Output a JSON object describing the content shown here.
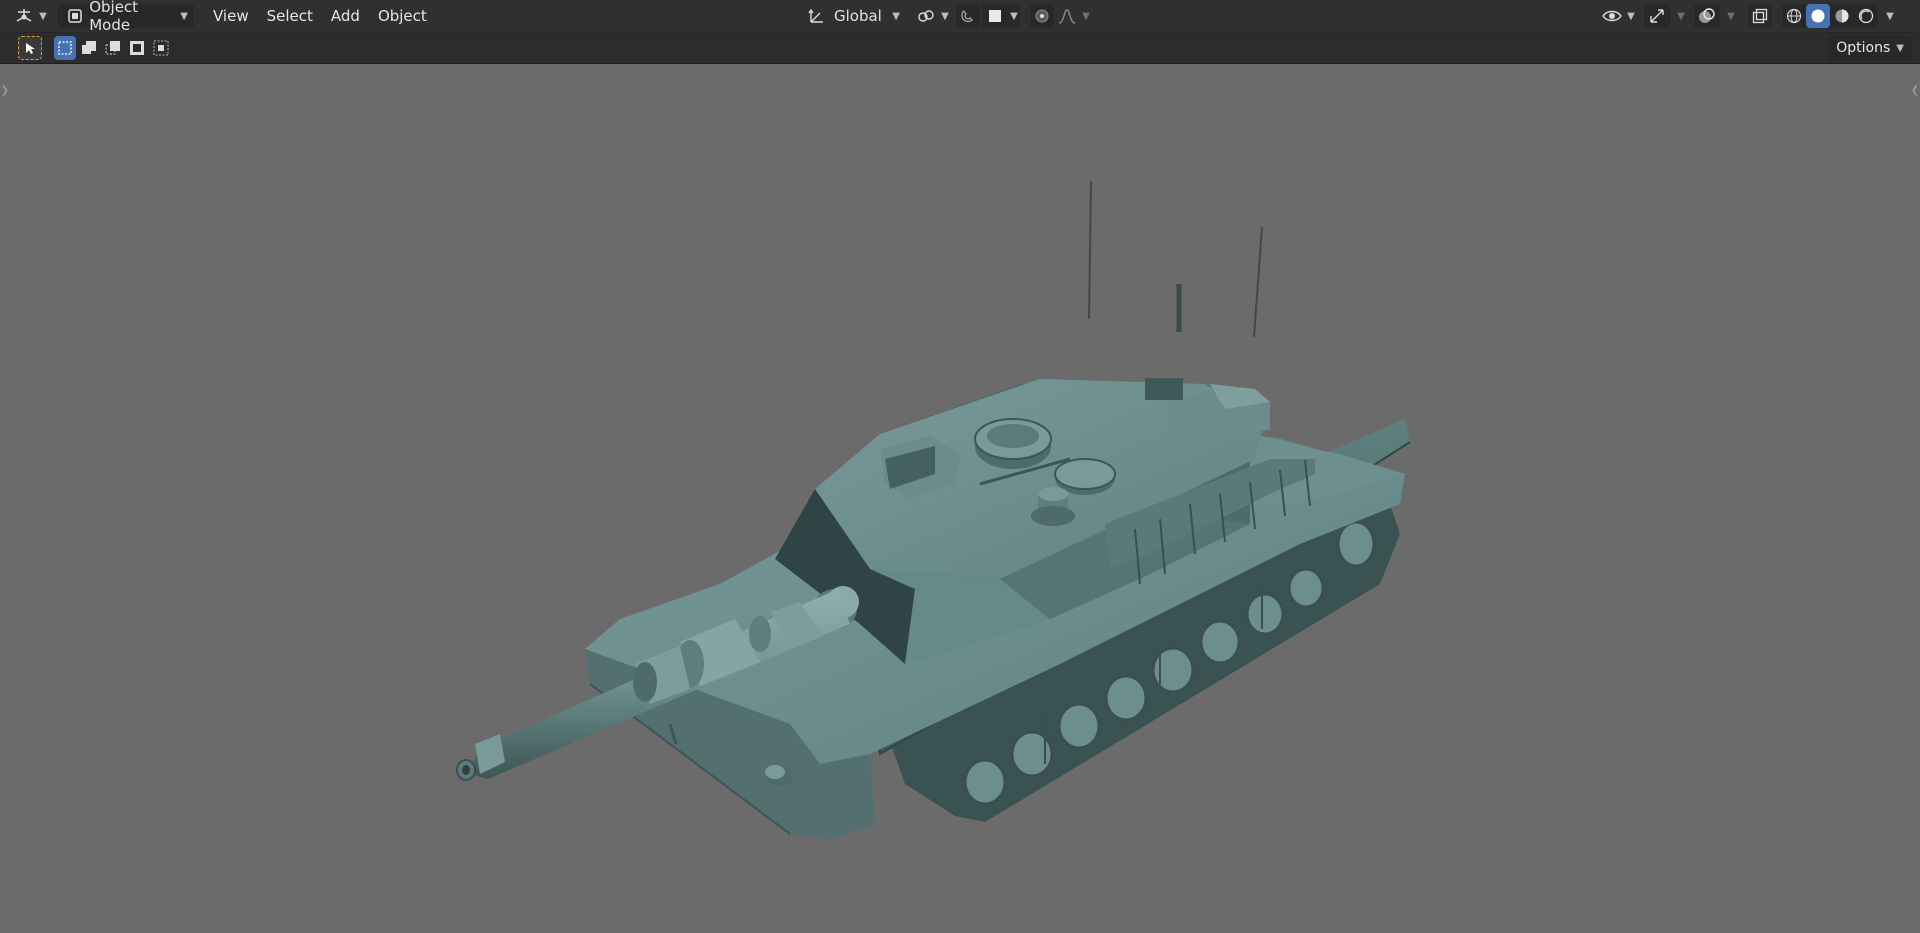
{
  "header": {
    "editor_type_icon": "3d-viewport-icon",
    "mode": {
      "icon": "object-mode-icon",
      "label": "Object Mode"
    },
    "menus": [
      "View",
      "Select",
      "Add",
      "Object"
    ],
    "transform_orientation": {
      "icon": "orientation-icon",
      "label": "Global"
    },
    "pivot_icon": "pivot-point-icon",
    "snap_icon": "snap-magnet-icon",
    "snap_target_icon": "snap-target-icon",
    "proportional_icon": "proportional-edit-icon",
    "falloff_icon": "falloff-curve-icon",
    "right": {
      "visibility_icon": "eye-icon",
      "gizmo_icon": "gizmo-icon",
      "overlay_icon": "overlay-icon",
      "xray_icon": "xray-icon",
      "shading": [
        "wireframe-shading-icon",
        "solid-shading-icon",
        "material-shading-icon",
        "rendered-shading-icon"
      ],
      "active_shading_index": 1
    }
  },
  "toolsettings": {
    "active_tool_icon": "select-box-tool-icon",
    "select_modes": [
      "set-new-icon",
      "extend-icon",
      "subtract-icon",
      "invert-icon",
      "intersect-icon"
    ],
    "options_label": "Options"
  },
  "colors": {
    "header_bg": "#303030",
    "viewport_bg": "#6b6b6b",
    "accent": "#4772b3",
    "active_tool": "#d9a030",
    "model_color": "#5f8080"
  }
}
